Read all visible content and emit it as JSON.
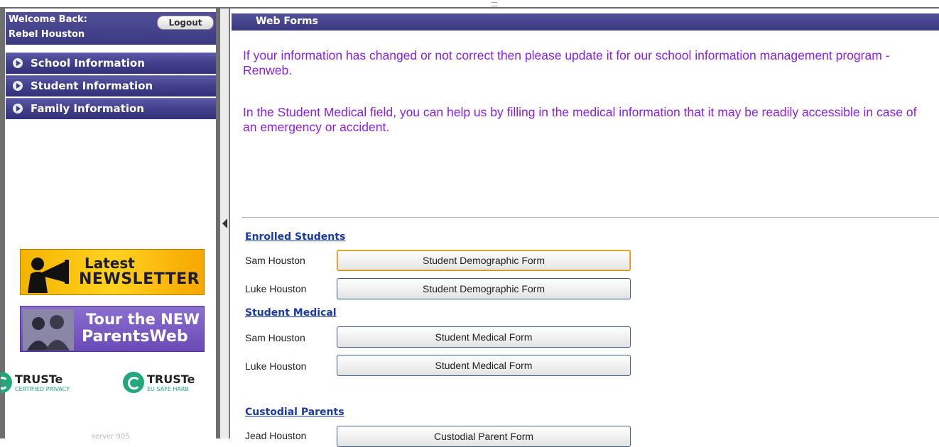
{
  "sidebar": {
    "welcome_label": "Welcome Back:",
    "user_name": "Rebel Houston",
    "logout_label": "Logout",
    "nav_items": [
      {
        "label": "School Information"
      },
      {
        "label": "Student Information"
      },
      {
        "label": "Family Information"
      }
    ],
    "newsletter_banner": {
      "line1": "Latest",
      "line2": "NEWSLETTER"
    },
    "parentsweb_banner": {
      "line1": "Tour the NEW",
      "line2": "ParentsWeb"
    },
    "truste_badges": [
      {
        "name": "TRUSTe",
        "subtitle": "CERTIFIED PRIVACY"
      },
      {
        "name": "TRUSTe",
        "subtitle": "EU SAFE HARB"
      }
    ],
    "server_label": "server 905"
  },
  "main": {
    "title": "Web Forms",
    "intro_paragraphs": [
      "If your information has changed or not correct then please update it for our school information management program -Renweb.",
      "In the Student Medical field, you can help us by filling in the medical information that it may be readily accessible in case of an emergency or accident."
    ],
    "sections": [
      {
        "heading": "Enrolled Students",
        "rows": [
          {
            "name": "Sam Houston",
            "button": "Student Demographic Form"
          },
          {
            "name": "Luke Houston",
            "button": "Student Demographic Form"
          }
        ]
      },
      {
        "heading": "Student Medical",
        "rows": [
          {
            "name": "Sam Houston",
            "button": "Student Medical Form"
          },
          {
            "name": "Luke Houston",
            "button": "Student Medical Form"
          }
        ]
      },
      {
        "heading": "Custodial Parents",
        "rows": [
          {
            "name": "Jead Houston",
            "button": "Custodial Parent Form"
          }
        ]
      }
    ]
  },
  "colors": {
    "header_purple": "#3b3980",
    "intro_text": "#8b1fe8",
    "section_link": "#1a3aa8"
  }
}
